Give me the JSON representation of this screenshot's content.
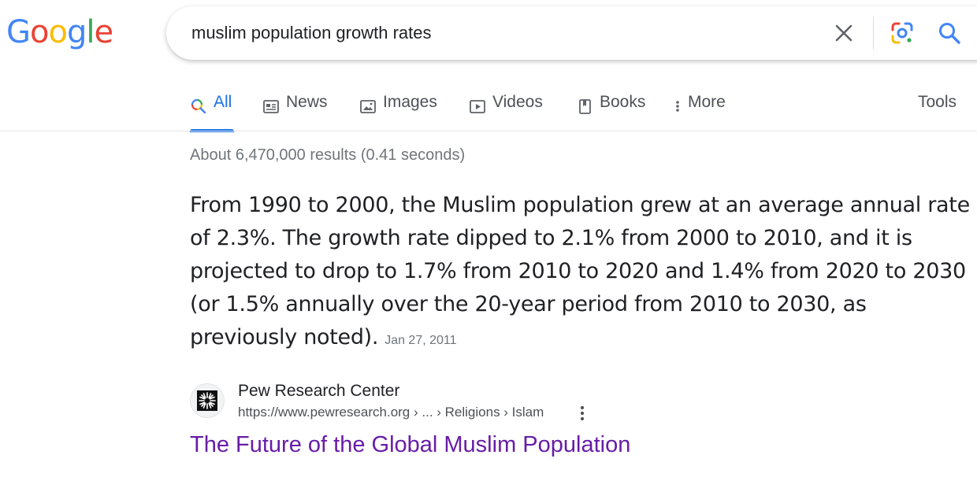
{
  "logo": {
    "letters": [
      "G",
      "o",
      "o",
      "g",
      "l",
      "e"
    ],
    "colors": [
      "#4285F4",
      "#EA4335",
      "#FBBC05",
      "#4285F4",
      "#34A853",
      "#EA4335"
    ]
  },
  "search": {
    "query": "muslim population growth rates",
    "clear_icon": "close-icon",
    "lens_icon": "google-lens-icon",
    "search_icon": "search-icon"
  },
  "tabs": [
    {
      "label": "All",
      "icon": "search-icon",
      "active": true
    },
    {
      "label": "News",
      "icon": "news-icon"
    },
    {
      "label": "Images",
      "icon": "image-icon"
    },
    {
      "label": "Videos",
      "icon": "video-icon"
    },
    {
      "label": "Books",
      "icon": "book-icon"
    },
    {
      "label": "More",
      "icon": "more-vert-icon"
    }
  ],
  "tools_label": "Tools",
  "stats": "About 6,470,000 results (0.41 seconds)",
  "featured_snippet": {
    "text": "From 1990 to 2000, the Muslim population grew at an average annual rate of 2.3%. The growth rate dipped to 2.1% from 2000 to 2010, and it is projected to drop to 1.7% from 2010 to 2020 and 1.4% from 2020 to 2030 (or 1.5% annually over the 20-year period from 2010 to 2030, as previously noted).",
    "date": "Jan 27, 2011"
  },
  "result": {
    "site_name": "Pew Research Center",
    "url": "https://www.pewresearch.org › ... › Religions › Islam",
    "title": "The Future of the Global Muslim Population"
  },
  "colors": {
    "accent": "#1a73e8",
    "visited_link": "#681da8",
    "secondary_text": "#70757a"
  }
}
